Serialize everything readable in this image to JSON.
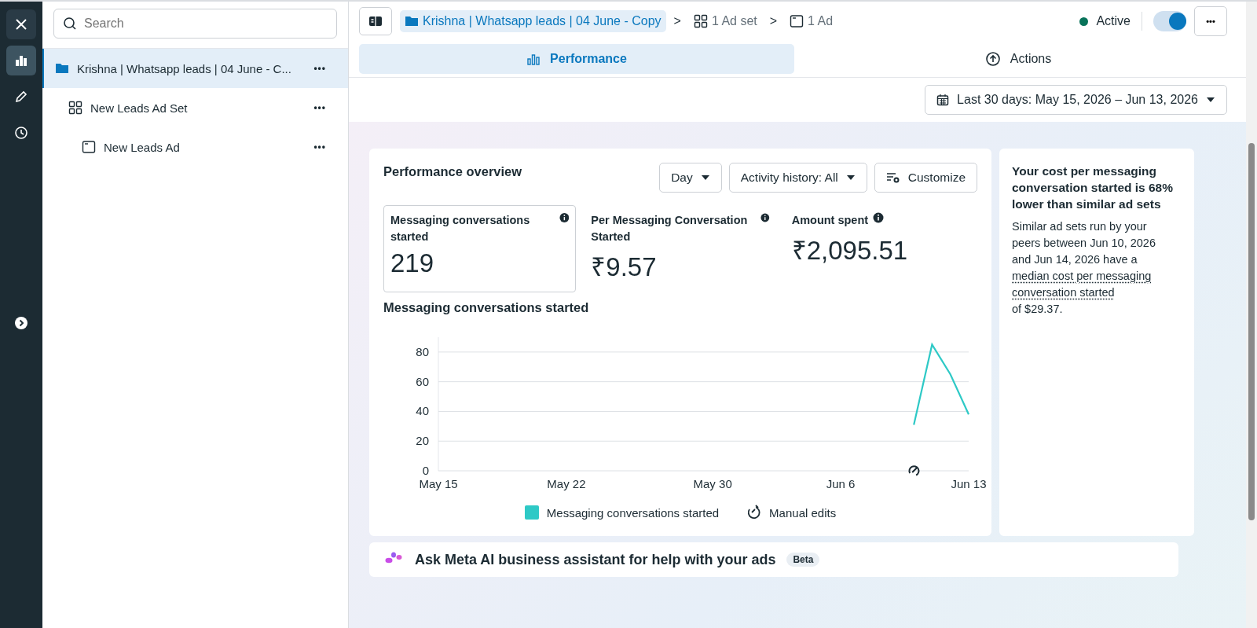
{
  "rail": {
    "items": [
      {
        "kind": "close",
        "selected": false
      },
      {
        "kind": "chart",
        "selected": true
      },
      {
        "kind": "edit",
        "selected": false
      },
      {
        "kind": "history",
        "selected": false
      },
      {
        "kind": "expand",
        "selected": false
      }
    ]
  },
  "sidebar": {
    "search": {
      "placeholder": "Search"
    },
    "tree": [
      {
        "kind": "campaign",
        "label": "Krishna | Whatsapp leads | 04 June - C...",
        "selected": true,
        "more": "•••",
        "children": [
          {
            "kind": "adset",
            "label": "New Leads Ad Set",
            "selected": false,
            "more": "•••",
            "children": [
              {
                "kind": "ad",
                "label": "New Leads Ad",
                "selected": false,
                "more": "•••"
              }
            ]
          }
        ]
      }
    ]
  },
  "header": {
    "breadcrumbs": [
      {
        "kind": "campaign",
        "label": "Krishna | Whatsapp leads | 04 June - Copy",
        "selected": true
      },
      {
        "kind": "adset",
        "label": "1 Ad set",
        "selected": false
      },
      {
        "kind": "ad",
        "label": "1 Ad",
        "selected": false
      }
    ],
    "separator": ">",
    "status": "Active",
    "toggle": {
      "on": true
    },
    "more": "•••"
  },
  "tabs": [
    {
      "kind": "performance",
      "label": "Performance",
      "selected": true
    },
    {
      "kind": "actions",
      "label": "Actions",
      "selected": false
    }
  ],
  "date_range": "Last 30 days: May 15, 2026 – Jun 13, 2026",
  "overview": {
    "title": "Performance overview",
    "controls": [
      {
        "kind": "dropdown",
        "label": "Day"
      },
      {
        "kind": "dropdown",
        "label": "Activity history: All"
      },
      {
        "kind": "customize",
        "label": "Customize"
      }
    ],
    "metrics": [
      {
        "label": "Messaging conversations started",
        "value": "219",
        "selected": true
      },
      {
        "label": "Per Messaging Conversation Started",
        "value": "₹9.57",
        "selected": false
      },
      {
        "label": "Amount spent",
        "value": "₹2,095.51",
        "selected": false
      }
    ],
    "chart_title": "Messaging conversations started",
    "chart_data": {
      "type": "line",
      "categories": [
        "May 15",
        null,
        null,
        null,
        null,
        null,
        null,
        "May 22",
        null,
        null,
        null,
        null,
        null,
        null,
        null,
        "May 30",
        null,
        null,
        null,
        null,
        null,
        null,
        "Jun 6",
        null,
        null,
        null,
        null,
        null,
        null,
        "Jun 13"
      ],
      "series": [
        {
          "name": "Messaging conversations started",
          "color": "#2ec9c6",
          "values": [
            null,
            null,
            null,
            null,
            null,
            null,
            null,
            null,
            null,
            null,
            null,
            null,
            null,
            null,
            null,
            null,
            null,
            null,
            null,
            null,
            null,
            null,
            null,
            null,
            null,
            null,
            31,
            85,
            65,
            38
          ]
        }
      ],
      "grid": true,
      "ylim": [
        0,
        90
      ],
      "yticks": [
        0,
        20,
        40,
        60,
        80
      ]
    },
    "legend": [
      {
        "kind": "manual_edit",
        "label": "Manual edits"
      }
    ]
  },
  "insight": {
    "title": "Your cost per messaging conversation started is 68% lower than similar ad sets",
    "text": "Similar ad sets run by your peers between Jun 10, 2026 and Jun 14, 2026 have a",
    "link": "median cost per messaging conversation started",
    "tail": "of $29.37."
  },
  "assistant": {
    "title": "Ask Meta AI business assistant for help with your ads",
    "badge": "Beta"
  }
}
